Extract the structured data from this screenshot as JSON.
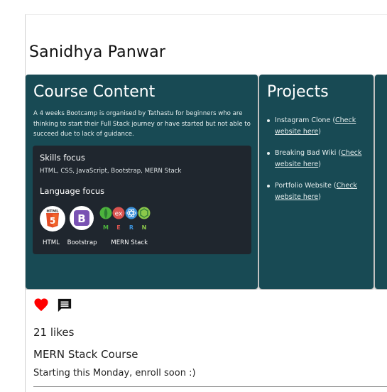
{
  "post": {
    "author": "Sanidhya Panwar",
    "likes": "21 likes",
    "title": "MERN Stack Course",
    "caption": "Starting this Monday, enroll soon :)"
  },
  "course_panel": {
    "title": "Course Content",
    "description": "A 4 weeks Bootcamp is organised by Tathastu for beginners who are thinking to start their Full Stack journey or have started but not able to succeed due to lack of guidance.",
    "skills_heading": "Skills focus",
    "skills_list": "HTML, CSS, JavaScript, Bootstrap, MERN Stack",
    "language_heading": "Language focus",
    "logos": {
      "html5_top_text": "HTML",
      "html5_badge": "5",
      "bootstrap_letter": "B",
      "mern_letters": [
        "M",
        "E",
        "R",
        "N"
      ]
    },
    "language_labels": [
      "HTML",
      "Bootstrap",
      "MERN Stack"
    ]
  },
  "projects_panel": {
    "title": "Projects",
    "items": [
      {
        "name": "Instagram Clone (",
        "link": "Check website here",
        "suffix": ")"
      },
      {
        "name": "Breaking Bad Wiki (",
        "link": "Check website here",
        "suffix": ")"
      },
      {
        "name": "Portfolio Website (",
        "link": "Check website here",
        "suffix": ")"
      }
    ]
  },
  "colors": {
    "panel_bg": "#184a54",
    "skills_box_bg": "#1f262e",
    "like_red": "#ff0000",
    "html5_orange": "#e44d26",
    "bootstrap_purple": "#7952b3",
    "mern_green": "#4db33d"
  },
  "icons": {
    "like": "heart-icon",
    "comment": "comment-icon"
  }
}
